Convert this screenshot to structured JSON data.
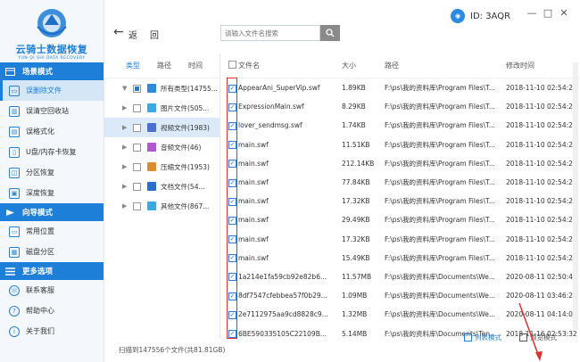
{
  "app": {
    "logo_title": "云骑士数据恢复",
    "logo_subtitle": "YUN QI SHI DATA RECOVERY",
    "user_id": "ID: 3AQR"
  },
  "sidebar": {
    "groups": [
      {
        "label": "场景模式",
        "items": [
          {
            "label": "误删除文件",
            "active": true
          },
          {
            "label": "误清空回收站"
          },
          {
            "label": "误格式化"
          },
          {
            "label": "U盘/内存卡恢复"
          },
          {
            "label": "分区恢复"
          },
          {
            "label": "深度恢复"
          }
        ]
      },
      {
        "label": "向导模式",
        "items": [
          {
            "label": "常用位置"
          },
          {
            "label": "磁盘分区"
          }
        ]
      },
      {
        "label": "更多选项",
        "items": [
          {
            "label": "联系客服"
          },
          {
            "label": "帮助中心"
          },
          {
            "label": "关于我们"
          }
        ]
      }
    ]
  },
  "toolbar": {
    "back_label": "返",
    "home_label": "回",
    "search_placeholder": "请输入文件名搜索"
  },
  "tree": {
    "tabs": [
      "类型",
      "路径",
      "时间"
    ],
    "rows": [
      {
        "label": "所有类型(14755...",
        "color": "#2a8be0"
      },
      {
        "label": "图片文件(505...",
        "color": "#3aa9e0"
      },
      {
        "label": "视频文件(1983)",
        "color": "#4b6fd1",
        "selected": true
      },
      {
        "label": "音频文件(46)",
        "color": "#b056d6"
      },
      {
        "label": "压缩文件(1953)",
        "color": "#e08a2a"
      },
      {
        "label": "文档文件(54...",
        "color": "#2a6fd0"
      },
      {
        "label": "其他文件(867...",
        "color": "#3aa9e0"
      }
    ]
  },
  "table": {
    "headers": {
      "name": "文件名",
      "size": "大小",
      "path": "路径",
      "date": "修改时间"
    },
    "rows": [
      {
        "name": "AppearAni_SuperVip.swf",
        "size": "1.89KB",
        "path": "F:\\ps\\我的资料库\\Program Files\\T...",
        "date": "2018-11-10 02:54:22"
      },
      {
        "name": "ExpressionMain.swf",
        "size": "8.29KB",
        "path": "F:\\ps\\我的资料库\\Program Files\\T...",
        "date": "2018-11-10 02:54:22"
      },
      {
        "name": "lover_sendmsg.swf",
        "size": "1.74KB",
        "path": "F:\\ps\\我的资料库\\Program Files\\T...",
        "date": "2018-11-10 02:54:22"
      },
      {
        "name": "main.swf",
        "size": "11.51KB",
        "path": "F:\\ps\\我的资料库\\Program Files\\T...",
        "date": "2018-11-10 02:54:22"
      },
      {
        "name": "main.swf",
        "size": "212.14KB",
        "path": "F:\\ps\\我的资料库\\Program Files\\T...",
        "date": "2018-11-10 02:54:22"
      },
      {
        "name": "main.swf",
        "size": "77.84KB",
        "path": "F:\\ps\\我的资料库\\Program Files\\T...",
        "date": "2018-11-10 02:54:22"
      },
      {
        "name": "main.swf",
        "size": "17.32KB",
        "path": "F:\\ps\\我的资料库\\Program Files\\T...",
        "date": "2018-11-10 02:54:22"
      },
      {
        "name": "main.swf",
        "size": "29.49KB",
        "path": "F:\\ps\\我的资料库\\Program Files\\T...",
        "date": "2018-11-10 02:54:22"
      },
      {
        "name": "main.swf",
        "size": "17.32KB",
        "path": "F:\\ps\\我的资料库\\Program Files\\T...",
        "date": "2018-11-10 02:54:22"
      },
      {
        "name": "main.swf",
        "size": "15.49KB",
        "path": "F:\\ps\\我的资料库\\Program Files\\T...",
        "date": "2018-11-10 02:54:22"
      },
      {
        "name": "1a214e1fa59cb92e82b6...",
        "size": "11.57MB",
        "path": "F:\\ps\\我的资料库\\Documents\\We...",
        "date": "2020-08-11 02:50:49"
      },
      {
        "name": "8df7547cfebbea57f0b29...",
        "size": "1.09MB",
        "path": "F:\\ps\\我的资料库\\Documents\\We...",
        "date": "2020-08-11 03:46:26"
      },
      {
        "name": "2e7112975aa9cd8828c9...",
        "size": "1.32MB",
        "path": "F:\\ps\\我的资料库\\Documents\\We...",
        "date": "2020-08-11 04:14:03"
      },
      {
        "name": "6BE590335105C22109B...",
        "size": "5.14MB",
        "path": "F:\\ps\\我的资料库\\Documents\\Ten...",
        "date": "2018-11-16 02:53:32"
      }
    ]
  },
  "footer": {
    "scan_status": "扫描到147556个文件(共81.81GB)",
    "list_mode": "列表模式",
    "preview_mode": "预览模式"
  },
  "colors": {
    "accent": "#1e7fd8",
    "highlight_box": "#e03030"
  }
}
